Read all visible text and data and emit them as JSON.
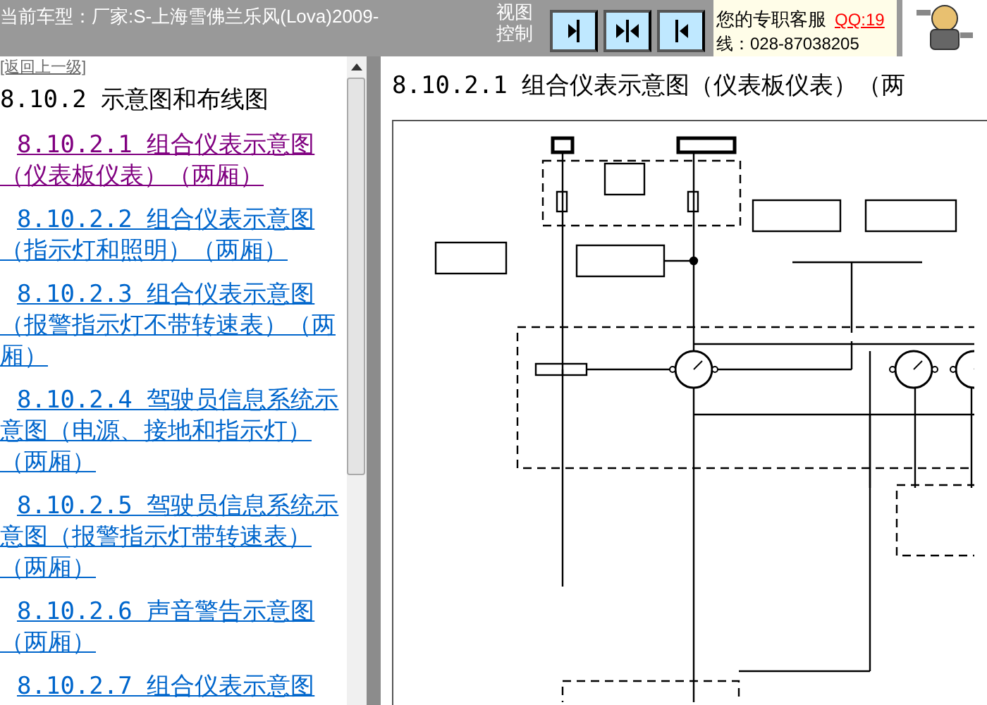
{
  "top_bar": {
    "car_model": "当前车型：厂家:S-上海雪佛兰乐风(Lova)2009-",
    "view_control": "视图控制",
    "view_buttons": [
      {
        "kind": "right"
      },
      {
        "kind": "both"
      },
      {
        "kind": "left"
      }
    ],
    "support": {
      "label": "您的专职客服",
      "qq": "QQ:19",
      "phone": "线：028-87038205"
    }
  },
  "sidebar": {
    "back_link": "[返回上一级]",
    "heading": "8.10.2 示意图和布线图",
    "links": [
      {
        "label": "8.10.2.1 组合仪表示意图（仪表板仪表）（两厢）",
        "visited": true
      },
      {
        "label": "8.10.2.2 组合仪表示意图（指示灯和照明）（两厢）",
        "visited": false
      },
      {
        "label": "8.10.2.3 组合仪表示意图（报警指示灯不带转速表）（两厢）",
        "visited": false
      },
      {
        "label": "8.10.2.4 驾驶员信息系统示意图（电源、接地和指示灯）（两厢）",
        "visited": false
      },
      {
        "label": "8.10.2.5 驾驶员信息系统示意图（报警指示灯带转速表）（两厢）",
        "visited": false
      },
      {
        "label": "8.10.2.6 声音警告示意图（两厢）",
        "visited": false
      },
      {
        "label": "8.10.2.7 组合仪表示意图",
        "visited": false
      }
    ]
  },
  "content": {
    "title": "8.10.2.1 组合仪表示意图（仪表板仪表）（两"
  }
}
